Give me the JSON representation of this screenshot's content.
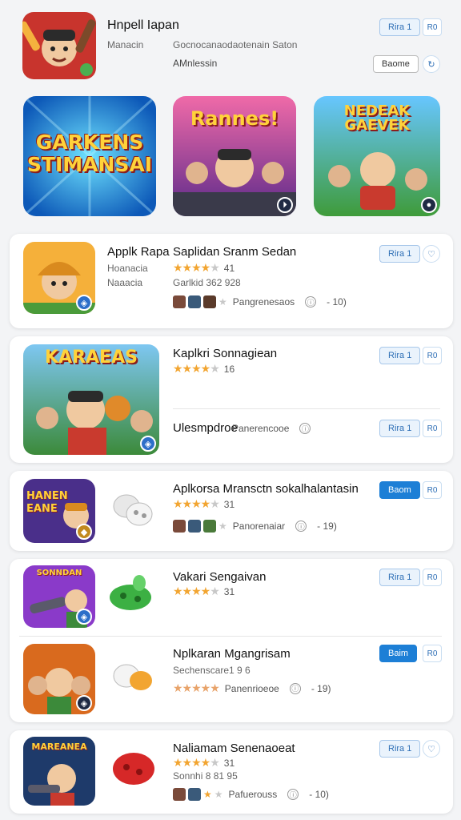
{
  "header": {
    "app_title": "Hnpell Iapan",
    "subtitle_left": "Manacin",
    "subtitle_right": "Gocnocanaodaotenain Saton",
    "subtitle_second": "AMnlessin",
    "get_label": "Rira 1",
    "small_label": "R0",
    "secondary_label": "Baome"
  },
  "featured": {
    "items": [
      {
        "text_lines": [
          "GARKENS",
          "STIMANSAI"
        ]
      },
      {
        "text_lines": [
          "Rannes!"
        ]
      },
      {
        "text_lines": [
          "NEDEAK",
          "GAEVEK"
        ]
      }
    ]
  },
  "list": {
    "item1": {
      "name": "Applk Rapa",
      "dev1": "Hoanacia",
      "dev2": "Naaacia",
      "title": "Saplidan Sranm Sedan",
      "rating": "41",
      "meta": "Garlkid 362 928",
      "social_text": "Pangrenesaos",
      "count": "- 10)",
      "get_label": "Rira 1"
    },
    "item2": {
      "banner_text": "KARAEAS",
      "title": "Kaplkri Sonnagiean",
      "rating": "16",
      "bottom_title": "Ulesmpdroe",
      "bottom_social": "Panerencooe",
      "get_label": "Rira 1",
      "small_label": "R0"
    },
    "item3": {
      "icon_text": [
        "HANEN",
        "EANE"
      ],
      "title": "Aplkorsa Mransctn sokalhalantasin",
      "rating": "31",
      "social_text": "Panorenaiar",
      "count": "- 19)",
      "get_label": "Baom",
      "small_label": "R0"
    },
    "item4": {
      "icon_text": "SONNDAN",
      "title": "Vakari Sengaivan",
      "rating": "31",
      "get_label": "Rira 1",
      "small_label": "R0"
    },
    "item5": {
      "title": "Nplkaran Mgangrisam",
      "meta": "Sechenscare1 9 6",
      "social_text": "Panenrioeoe",
      "count": "- 19)",
      "get_label": "Baim",
      "small_label": "R0"
    },
    "item6": {
      "icon_text": "MAREANEA",
      "title": "Naliamam Senenaoeat",
      "rating": "31",
      "meta": "Sonnhi 8 81 95",
      "social_text": "Pafuerouss",
      "count": "- 10)",
      "get_label": "Rira 1"
    }
  },
  "colors": {
    "accent": "#1d7fd6",
    "star": "#f2a531",
    "background": "#f3f4f6"
  }
}
